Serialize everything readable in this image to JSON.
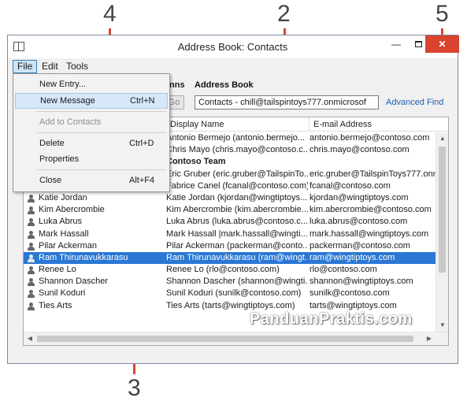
{
  "callouts": [
    "4",
    "2",
    "5",
    "3"
  ],
  "window": {
    "title": "Address Book: Contacts",
    "close_glyph": "✕",
    "min_glyph": "—"
  },
  "menubar": {
    "file": "File",
    "edit": "Edit",
    "tools": "Tools"
  },
  "toolbar": {
    "columns_partial": "nns",
    "address_book_label": "Address Book",
    "go_label": "Go",
    "address_book_value": "Contacts - chill@tailspintoys777.onmicrosof",
    "advanced_find": "Advanced Find"
  },
  "file_menu": {
    "new_entry": "New Entry...",
    "new_message": "New Message",
    "new_message_shortcut": "Ctrl+N",
    "add_to_contacts": "Add to Contacts",
    "delete": "Delete",
    "delete_shortcut": "Ctrl+D",
    "properties": "Properties",
    "close": "Close",
    "close_shortcut": "Alt+F4"
  },
  "list": {
    "columns": {
      "display_name": "Display Name",
      "email": "E-mail Address"
    },
    "rows": [
      {
        "name": "",
        "display": "Antonio Bermejo (antonio.bermejo...",
        "email": "antonio.bermejo@contoso.com",
        "icon": false
      },
      {
        "name": "",
        "display": "Chris Mayo (chris.mayo@contoso.c...",
        "email": "chris.mayo@contoso.com",
        "icon": false
      },
      {
        "name": "",
        "display": "Contoso Team",
        "email": "",
        "icon": false,
        "bold": true
      },
      {
        "name": "",
        "display": "Eric Gruber (eric.gruber@TailspinTo...",
        "email": "eric.gruber@TailspinToys777.onm",
        "icon": false
      },
      {
        "name": "",
        "display": "Fabrice Canel (fcanal@contoso.com)",
        "email": "fcanal@contoso.com",
        "icon": false
      },
      {
        "name": "Katie Jordan",
        "display": "Katie Jordan (kjordan@wingtiptoys...",
        "email": "kjordan@wingtiptoys.com",
        "icon": true
      },
      {
        "name": "Kim Abercrombie",
        "display": "Kim Abercrombie (kim.abercrombie...",
        "email": "kim.abercrombie@contoso.com",
        "icon": true
      },
      {
        "name": "Luka Abrus",
        "display": "Luka Abrus (luka.abrus@contoso.c...",
        "email": "luka.abrus@contoso.com",
        "icon": true
      },
      {
        "name": "Mark Hassall",
        "display": "Mark Hassall |mark.hassall@wingti...",
        "email": "mark.hassall@wingtiptoys.com",
        "icon": true
      },
      {
        "name": "Pilar Ackerman",
        "display": "Pilar Ackerman (packerman@conto...",
        "email": "packerman@contoso.com",
        "icon": true
      },
      {
        "name": "Ram Thirunavukkarasu",
        "display": "Ram Thirunavukkarasu (ram@wingt...",
        "email": "ram@wingtiptoys.com",
        "icon": true,
        "selected": true
      },
      {
        "name": "Renee Lo",
        "display": "Renee Lo (rlo@contoso.com)",
        "email": "rlo@contoso.com",
        "icon": true
      },
      {
        "name": "Shannon Dascher",
        "display": "Shannon Dascher (shannon@wingti...",
        "email": "shannon@wingtiptoys.com",
        "icon": true
      },
      {
        "name": "Sunil Koduri",
        "display": "Sunil Koduri (sunilk@contoso.com)",
        "email": "sunilk@contoso.com",
        "icon": true
      },
      {
        "name": "Ties Arts",
        "display": "Ties Arts (tarts@wingtiptoys.com)",
        "email": "tarts@wingtiptoys.com",
        "icon": true
      }
    ]
  },
  "watermark": "PanduanPraktis.com",
  "colors": {
    "callout_line": "#d9452f",
    "selection": "#2a77d4",
    "close_button": "#d9432f",
    "link": "#1f5fb4"
  }
}
